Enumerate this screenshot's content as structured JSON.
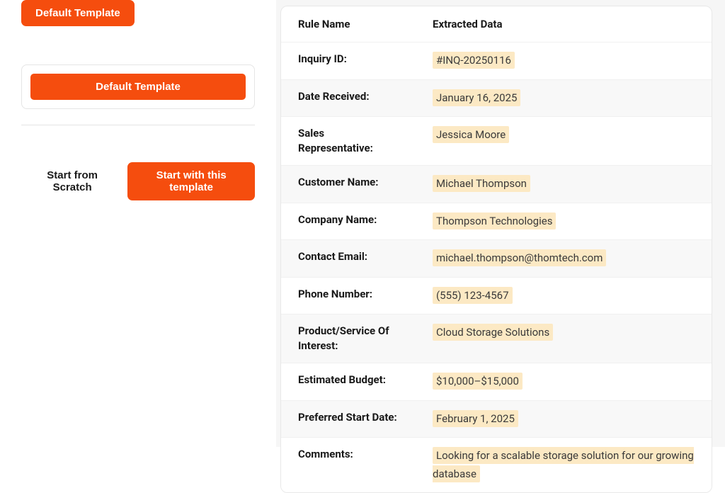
{
  "left": {
    "default_template_btn": "Default Template",
    "card_template_btn": "Default Template",
    "start_scratch": "Start from Scratch",
    "start_with_template": "Start with this template"
  },
  "table": {
    "headers": {
      "rule": "Rule Name",
      "extracted": "Extracted Data"
    },
    "rows": [
      {
        "rule": "Inquiry ID:",
        "value": "#INQ-20250116"
      },
      {
        "rule": "Date Received:",
        "value": "January 16, 2025"
      },
      {
        "rule": "Sales Representative:",
        "value": "Jessica Moore"
      },
      {
        "rule": "Customer Name:",
        "value": "Michael Thompson"
      },
      {
        "rule": "Company Name:",
        "value": "Thompson Technologies"
      },
      {
        "rule": "Contact Email:",
        "value": "michael.thompson@thomtech.com"
      },
      {
        "rule": "Phone Number:",
        "value": "(555) 123-4567"
      },
      {
        "rule": "Product/Service Of Interest:",
        "value": "Cloud Storage Solutions"
      },
      {
        "rule": "Estimated Budget:",
        "value": "$10,000–$15,000"
      },
      {
        "rule": "Preferred Start Date:",
        "value": "February 1, 2025"
      },
      {
        "rule": "Comments:",
        "value": " Looking for a scalable storage solution for our growing database"
      }
    ]
  }
}
